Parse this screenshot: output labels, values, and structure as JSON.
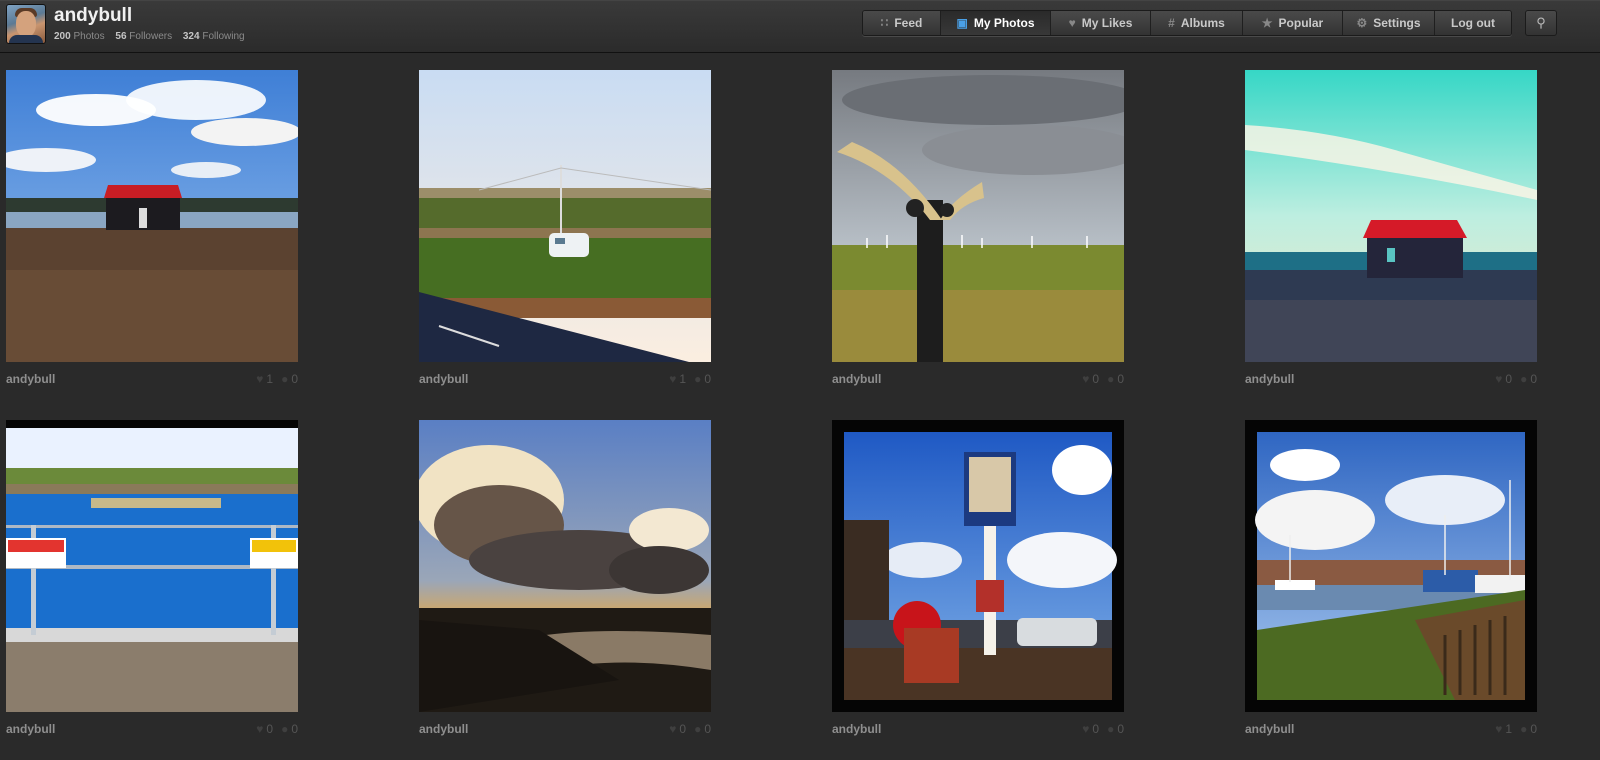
{
  "profile": {
    "username": "andybull",
    "stats": [
      {
        "value": "200",
        "label": "Photos"
      },
      {
        "value": "56",
        "label": "Followers"
      },
      {
        "value": "324",
        "label": "Following"
      }
    ]
  },
  "nav": [
    {
      "key": "feed",
      "label": "Feed",
      "icon": "rss-icon",
      "glyph": "∷",
      "active": false
    },
    {
      "key": "my-photos",
      "label": "My Photos",
      "icon": "camera-icon",
      "glyph": "▣",
      "active": true
    },
    {
      "key": "my-likes",
      "label": "My Likes",
      "icon": "heart-icon",
      "glyph": "♥",
      "active": false
    },
    {
      "key": "albums",
      "label": "Albums",
      "icon": "hash-icon",
      "glyph": "#",
      "active": false
    },
    {
      "key": "popular",
      "label": "Popular",
      "icon": "star-icon",
      "glyph": "★",
      "active": false
    },
    {
      "key": "settings",
      "label": "Settings",
      "icon": "gear-icon",
      "glyph": "⚙",
      "active": false
    },
    {
      "key": "logout",
      "label": "Log out",
      "icon": "",
      "glyph": "",
      "active": false
    }
  ],
  "search": {
    "icon": "search-icon"
  },
  "colors": {
    "accent": "#4aa0e6",
    "background": "#2a2a2a"
  },
  "photos": [
    {
      "owner": "andybull",
      "likes": "1",
      "comments": "0",
      "scene": "red-hut-lake"
    },
    {
      "owner": "andybull",
      "likes": "1",
      "comments": "0",
      "scene": "caravan-field"
    },
    {
      "owner": "andybull",
      "likes": "0",
      "comments": "0",
      "scene": "signpost"
    },
    {
      "owner": "andybull",
      "likes": "0",
      "comments": "0",
      "scene": "red-hut-beach"
    },
    {
      "owner": "andybull",
      "likes": "0",
      "comments": "0",
      "scene": "reservoir-signs"
    },
    {
      "owner": "andybull",
      "likes": "0",
      "comments": "0",
      "scene": "stormy-sunset"
    },
    {
      "owner": "andybull",
      "likes": "0",
      "comments": "0",
      "scene": "pub-sign"
    },
    {
      "owner": "andybull",
      "likes": "1",
      "comments": "0",
      "scene": "harbour-boats"
    }
  ]
}
